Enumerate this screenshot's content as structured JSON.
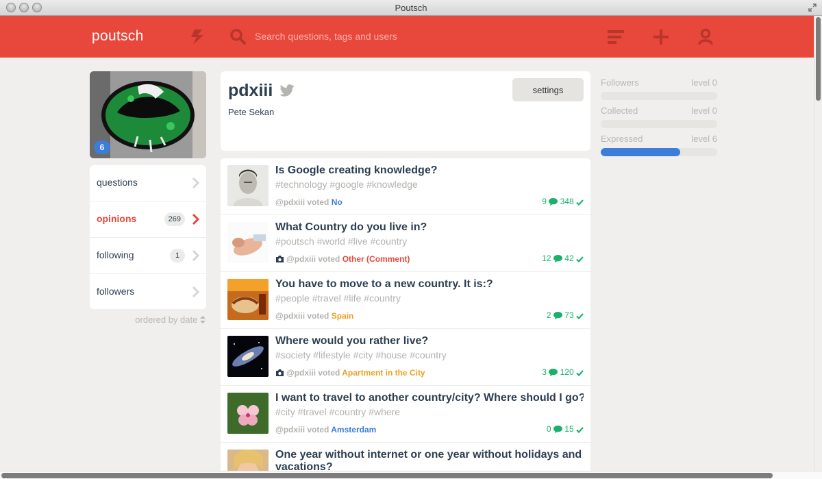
{
  "window": {
    "title": "Poutsch"
  },
  "topbar": {
    "brand": "poutsch",
    "search_placeholder": "Search questions, tags and users",
    "icons": [
      "bolt-icon",
      "search-icon",
      "menu-icon",
      "plus-icon",
      "user-icon"
    ],
    "bg_color": "#e8473c"
  },
  "profile": {
    "avatar_badge": "6",
    "username": "pdxiii",
    "fullname": "Pete Sekan",
    "settings_label": "settings"
  },
  "sidebar": {
    "items": [
      {
        "label": "questions",
        "count": ""
      },
      {
        "label": "opinions",
        "count": "269",
        "active": true
      },
      {
        "label": "following",
        "count": "1"
      },
      {
        "label": "followers",
        "count": ""
      }
    ],
    "ordered_label": "ordered by date"
  },
  "stats": [
    {
      "name": "Followers",
      "level": "level 0",
      "progress": 0
    },
    {
      "name": "Collected",
      "level": "level 0",
      "progress": 0
    },
    {
      "name": "Expressed",
      "level": "level 6",
      "progress": 0.68
    }
  ],
  "feed": [
    {
      "title": "Is Google creating knowledge?",
      "tags": "#technology #google #knowledge",
      "user": "@pdxiii voted",
      "vote": "No",
      "vote_color": "#3b7dd8",
      "camera": false,
      "comments": "9",
      "votes": "348"
    },
    {
      "title": "What Country do you live in?",
      "tags": "#poutsch #world #live #country",
      "user": "@pdxiii voted",
      "vote": "Other (Comment)",
      "vote_color": "#e8473c",
      "camera": true,
      "comments": "12",
      "votes": "42"
    },
    {
      "title": "You have to move to a new country. It is:?",
      "tags": "#people #travel #life #country",
      "user": "@pdxiii voted",
      "vote": "Spain",
      "vote_color": "#f0a020",
      "camera": false,
      "comments": "2",
      "votes": "73"
    },
    {
      "title": "Where would you rather live?",
      "tags": "#society #lifestyle #city #house #country",
      "user": "@pdxiii voted",
      "vote": "Apartment in the City",
      "vote_color": "#f0a020",
      "camera": true,
      "comments": "3",
      "votes": "120"
    },
    {
      "title": "I want to travel to another country/city? Where should I go?",
      "tags": "#city #travel #country #where",
      "user": "@pdxiii voted",
      "vote": "Amsterdam",
      "vote_color": "#3b7dd8",
      "camera": false,
      "comments": "0",
      "votes": "15"
    },
    {
      "title": "One year without internet or one year without holidays and vacations?",
      "tags": "",
      "user": "",
      "vote": "",
      "vote_color": "#3b7dd8",
      "camera": false,
      "comments": "",
      "votes": ""
    }
  ]
}
